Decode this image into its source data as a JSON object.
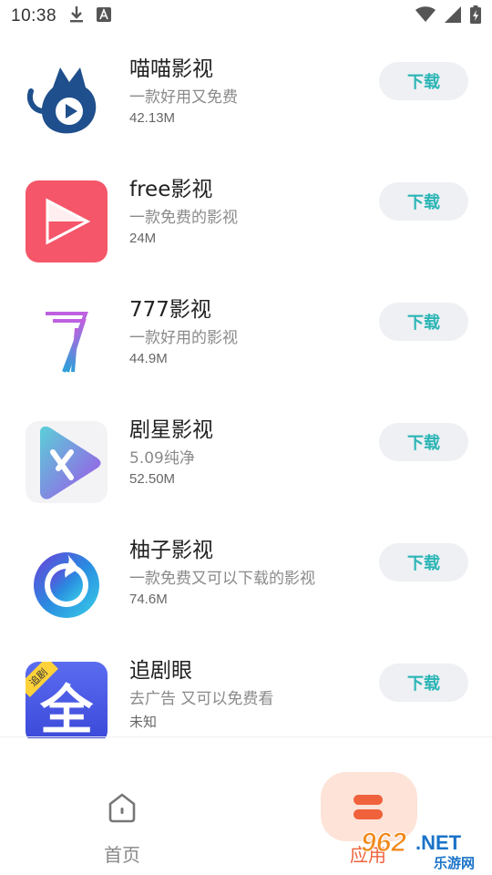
{
  "status_bar": {
    "time": "10:38",
    "icons": [
      "download-icon",
      "a-notification-icon",
      "wifi-icon",
      "cell-signal-icon",
      "battery-icon"
    ]
  },
  "apps": [
    {
      "name": "喵喵影视",
      "desc": "一款好用又免费",
      "size": "42.13M",
      "button": "下载",
      "icon": "cat-play-icon"
    },
    {
      "name": "free影视",
      "desc": "一款免费的影视",
      "size": "24M",
      "button": "下载",
      "icon": "play-triangle-icon"
    },
    {
      "name": "777影视",
      "desc": "一款好用的影视",
      "size": "44.9M",
      "button": "下载",
      "icon": "777-logo-icon"
    },
    {
      "name": "剧星影视",
      "desc": "5.09纯净",
      "size": "52.50M",
      "button": "下载",
      "icon": "x-play-icon"
    },
    {
      "name": "柚子影视",
      "desc": "一款免费又可以下载的影视",
      "size": "74.6M",
      "button": "下载",
      "icon": "swirl-logo-icon"
    },
    {
      "name": "追剧眼",
      "desc": "去广告 又可以免费看",
      "size": "未知",
      "button": "下载",
      "icon": "quan-logo-icon",
      "badge": "追剧",
      "logo_text": "全"
    }
  ],
  "bottom_nav": {
    "home_label": "首页",
    "apps_label": "应用"
  },
  "watermark": {
    "number": "962",
    "suffix": ".NET",
    "site": "乐游网"
  },
  "colors": {
    "accent_teal": "#2bb5b5",
    "nav_active": "#f0623c",
    "nav_active_bg": "#fde3d8",
    "button_bg": "#eef0f4"
  }
}
